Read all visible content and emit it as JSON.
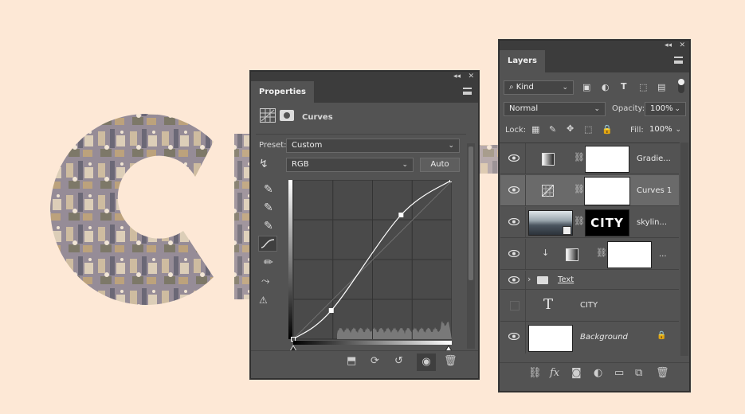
{
  "canvas": {
    "background": "#fde8d6"
  },
  "properties": {
    "tab_label": "Properties",
    "adjustment_name": "Curves",
    "preset_label": "Preset:",
    "preset_value": "Custom",
    "channel_value": "RGB",
    "auto_button": "Auto",
    "curve_points": [
      [
        0,
        0
      ],
      [
        0.24,
        0.18
      ],
      [
        0.68,
        0.78
      ],
      [
        1,
        1
      ]
    ]
  },
  "layers": {
    "tab_label": "Layers",
    "filter_kind": "Kind",
    "blend_mode": "Normal",
    "opacity_label": "Opacity:",
    "opacity_value": "100%",
    "lock_label": "Lock:",
    "fill_label": "Fill:",
    "fill_value": "100%",
    "rows": [
      {
        "name": "Gradie...",
        "visible": true
      },
      {
        "name": "Curves 1",
        "visible": true,
        "selected": true
      },
      {
        "name": "skylin...",
        "mask_text": "CITY",
        "visible": true
      },
      {
        "name": "...",
        "visible": true
      },
      {
        "name": "Text",
        "visible": true
      },
      {
        "name": "CITY",
        "visible": false
      },
      {
        "name": "Background",
        "visible": true
      }
    ]
  }
}
